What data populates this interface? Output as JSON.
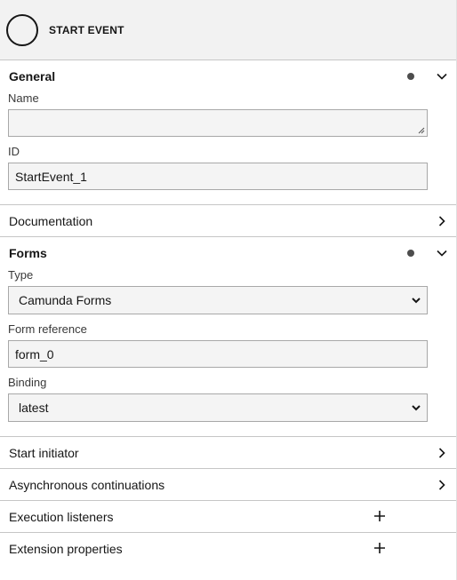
{
  "header": {
    "title": "START EVENT"
  },
  "groups": {
    "general": {
      "title": "General",
      "name_label": "Name",
      "name_value": "",
      "id_label": "ID",
      "id_value": "StartEvent_1"
    },
    "documentation": {
      "title": "Documentation"
    },
    "forms": {
      "title": "Forms",
      "type_label": "Type",
      "type_value": "Camunda Forms",
      "form_ref_label": "Form reference",
      "form_ref_value": "form_0",
      "binding_label": "Binding",
      "binding_value": "latest"
    },
    "start_initiator": {
      "title": "Start initiator"
    },
    "async": {
      "title": "Asynchronous continuations"
    },
    "execution_listeners": {
      "title": "Execution listeners"
    },
    "extension_properties": {
      "title": "Extension properties"
    }
  },
  "icons": {
    "event": "start-event-circle-icon",
    "dot": "data-dot-icon",
    "expand": "chevron-down-icon",
    "collapsed": "chevron-right-icon",
    "add": "plus-icon"
  }
}
